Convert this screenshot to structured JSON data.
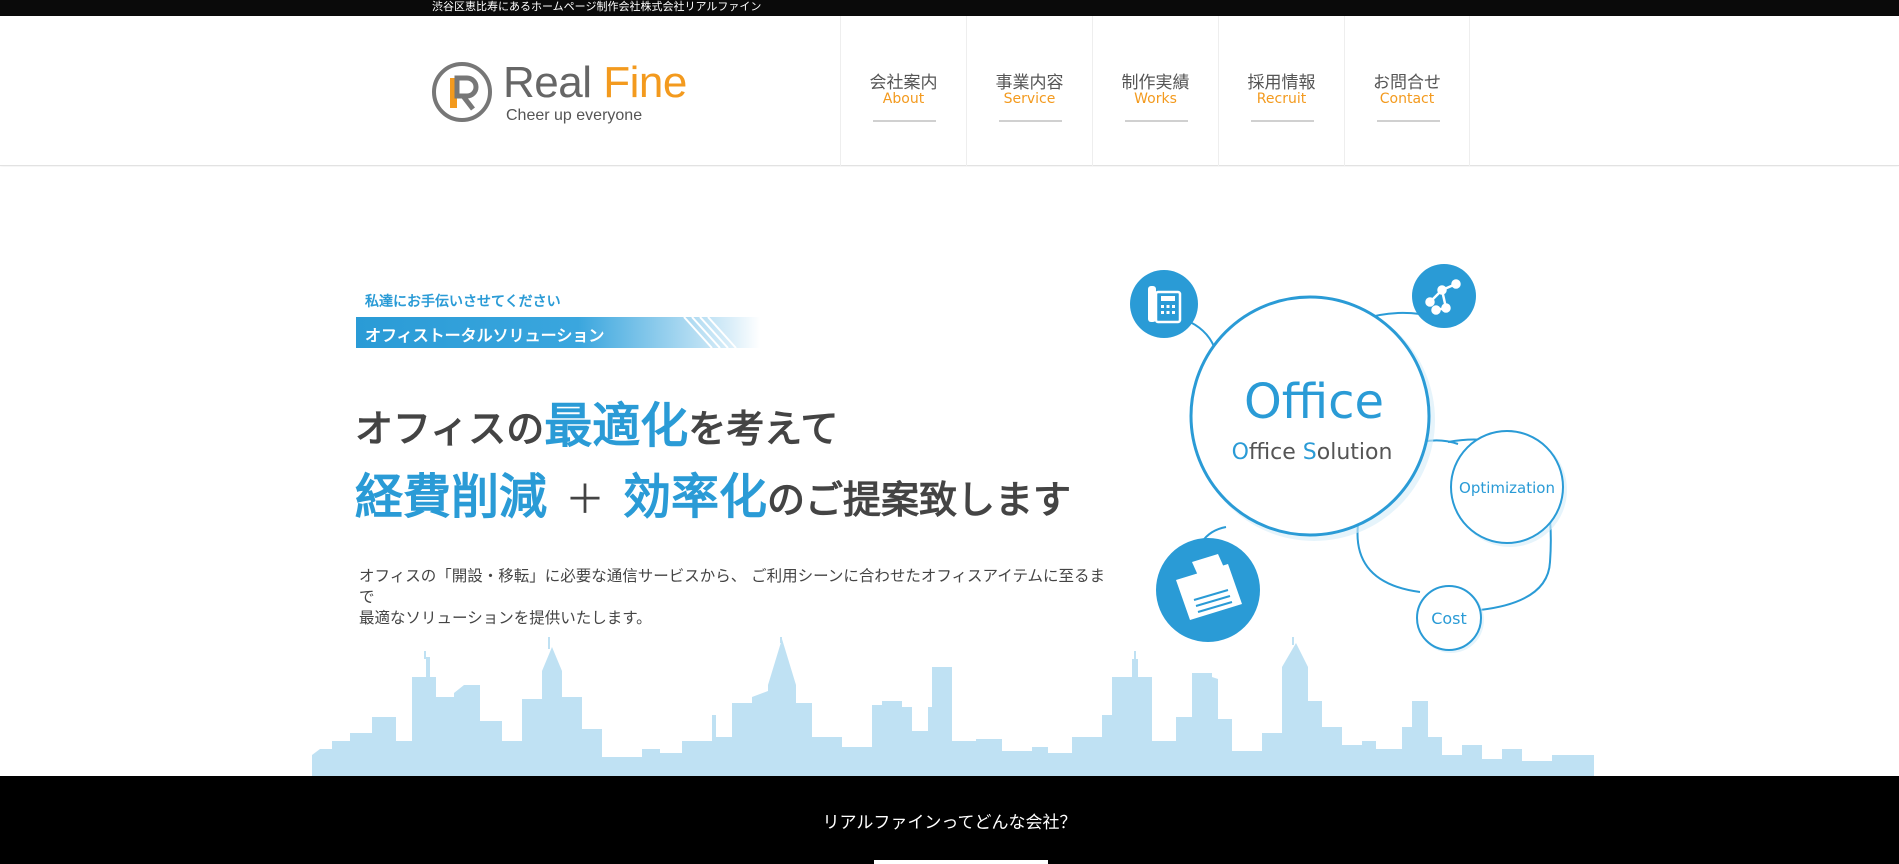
{
  "topbar": {
    "text": "渋谷区恵比寿にあるホームページ制作会社株式会社リアルファイン"
  },
  "logo": {
    "name_main": "Real ",
    "name_accent": "Fine",
    "tagline": "Cheer up everyone"
  },
  "nav": [
    {
      "jp": "会社案内",
      "en": "About"
    },
    {
      "jp": "事業内容",
      "en": "Service"
    },
    {
      "jp": "制作実績",
      "en": "Works"
    },
    {
      "jp": "採用情報",
      "en": "Recruit"
    },
    {
      "jp": "お問合せ",
      "en": "Contact"
    }
  ],
  "hero": {
    "tagline": "私達にお手伝いさせてください",
    "ribbon": "オフィストータルソリューション",
    "line1_pre": "オフィスの",
    "line1_big": "最適化",
    "line1_post": "を考えて",
    "line2_big1": "経費削減",
    "line2_plus": "＋",
    "line2_big2": "効率化",
    "line2_post": "のご提案致します",
    "desc_line1": "オフィスの「開設・移転」に必要な通信サービスから、 ご利用シーンに合わせたオフィスアイテムに至るまで",
    "desc_line2": "最適なソリューションを提供いたします。"
  },
  "diagram": {
    "center_title": "Office",
    "center_sub_o": "O",
    "center_sub_1": "ffice ",
    "center_sub_s": "S",
    "center_sub_2": "olution",
    "node_optimization": "Optimization",
    "node_cost": "Cost",
    "icons": [
      "phone-icon",
      "network-icon",
      "printer-icon"
    ],
    "accent_color": "#2a9bd6"
  },
  "band": {
    "text": "リアルファインってどんな会社？"
  },
  "colors": {
    "brand_orange": "#f39a1e",
    "brand_blue": "#2a9bd6",
    "skyline": "#bfe1f3"
  }
}
